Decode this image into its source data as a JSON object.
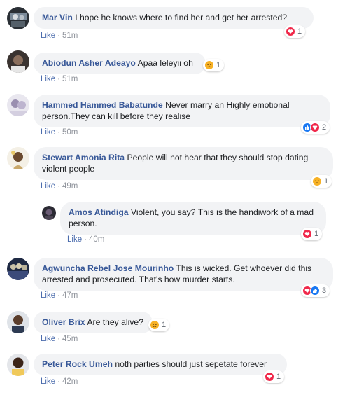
{
  "colors": {
    "author": "#385898",
    "bubble": "#f2f3f5",
    "meta": "#90949c",
    "love": "#f0284a",
    "like": "#1877f2",
    "sad": "#f7b125"
  },
  "like_label": "Like",
  "comments": [
    {
      "author": "Mar Vin",
      "text": "I hope he knows where to find her and get her arrested?",
      "time": "51m",
      "reactions": [
        "love-icon"
      ],
      "count": "1"
    },
    {
      "author": "Abiodun Asher Adeayo",
      "text": "Apaa leleyii oh",
      "time": "51m",
      "reactions": [
        "sad-icon"
      ],
      "count": "1"
    },
    {
      "author": "Hammed Hammed Babatunde",
      "text": "Never marry an Highly emotional person.They can kill before they realise",
      "time": "50m",
      "reactions": [
        "like-icon",
        "love-icon"
      ],
      "count": "2"
    },
    {
      "author": "Stewart Amonia Rita",
      "text": "People will not hear that they should stop dating violent people",
      "time": "49m",
      "reactions": [
        "sad-icon"
      ],
      "count": "1"
    },
    {
      "author": "Amos Atindiga",
      "text": "Violent, you say? This is the handiwork of a mad person.",
      "time": "40m",
      "reactions": [
        "love-icon"
      ],
      "count": "1"
    },
    {
      "author": "Agwuncha Rebel Jose Mourinho",
      "text": "This is wicked. Get whoever did this arrested and prosecuted. That's how murder starts.",
      "time": "47m",
      "reactions": [
        "love-icon",
        "like-icon"
      ],
      "count": "3"
    },
    {
      "author": "Oliver Brix",
      "text": "Are they alive?",
      "time": "45m",
      "reactions": [
        "sad-icon"
      ],
      "count": "1"
    },
    {
      "author": "Peter Rock Umeh",
      "text": "noth parties should just sepetate forever",
      "time": "42m",
      "reactions": [
        "love-icon"
      ],
      "count": "1"
    }
  ]
}
